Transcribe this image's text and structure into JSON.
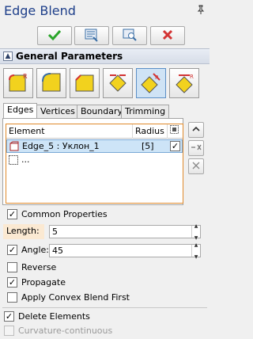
{
  "window": {
    "title": "Edge Blend",
    "pin_icon": "pin-icon"
  },
  "toolbar": {
    "buttons": [
      {
        "name": "ok-button",
        "icon": "check-icon",
        "color": "#2aa52a"
      },
      {
        "name": "preview-button",
        "icon": "preview-icon",
        "color": "#3a6ea5"
      },
      {
        "name": "zoom-preview-button",
        "icon": "magnifier-icon",
        "color": "#3a6ea5"
      },
      {
        "name": "cancel-button",
        "icon": "close-icon",
        "color": "#d33434"
      }
    ]
  },
  "section": {
    "title": "General Parameters",
    "collapse_icon": "collapse-up-icon"
  },
  "modes": [
    {
      "name": "mode-edge-fillet",
      "icon": "edge-fillet-icon"
    },
    {
      "name": "mode-corner-blend",
      "icon": "corner-blend-icon"
    },
    {
      "name": "mode-chamfer",
      "icon": "chamfer-icon"
    },
    {
      "name": "mode-vertex-blend",
      "icon": "vertex-blend-icon"
    },
    {
      "name": "mode-face-blend",
      "icon": "face-blend-icon",
      "active": true
    },
    {
      "name": "mode-setback-blend",
      "icon": "setback-blend-icon"
    }
  ],
  "tabs": [
    "Edges",
    "Vertices",
    "Boundary",
    "Trimming"
  ],
  "active_tab": "Edges",
  "grid": {
    "headers": {
      "element": "Element",
      "radius": "Radius"
    },
    "rows": [
      {
        "element": "Edge_5 : Уклон_1",
        "radius": "[5]",
        "checked": "✓"
      },
      {
        "element": "...",
        "radius": "",
        "checked": ""
      }
    ]
  },
  "side_buttons": [
    "move-up-button",
    "replace-button",
    "delete-button"
  ],
  "common_properties": {
    "label": "Common Properties",
    "checked": "✓"
  },
  "length": {
    "label": "Length:",
    "value": "5"
  },
  "angle": {
    "label": "Angle:",
    "value": "45",
    "checked": "✓"
  },
  "reverse": {
    "label": "Reverse",
    "checked": ""
  },
  "propagate": {
    "label": "Propagate",
    "checked": "✓"
  },
  "convex_first": {
    "label": "Apply Convex Blend First",
    "checked": ""
  },
  "delete_elements": {
    "label": "Delete Elements",
    "checked": "✓"
  },
  "curvature": {
    "label": "Curvature-continuous",
    "checked": ""
  }
}
